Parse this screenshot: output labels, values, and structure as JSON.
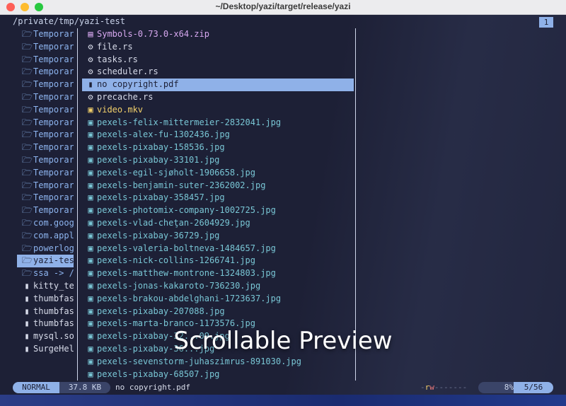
{
  "window": {
    "title": "~/Desktop/yazi/target/release/yazi"
  },
  "header": {
    "path": "/private/tmp/yazi-test",
    "tab": "1"
  },
  "parent": [
    {
      "icon": "folder-open-icon",
      "glyph": "🗁",
      "name": "Temporar",
      "kind": "dir"
    },
    {
      "icon": "folder-open-icon",
      "glyph": "🗁",
      "name": "Temporar",
      "kind": "dir"
    },
    {
      "icon": "folder-open-icon",
      "glyph": "🗁",
      "name": "Temporar",
      "kind": "dir"
    },
    {
      "icon": "folder-open-icon",
      "glyph": "🗁",
      "name": "Temporar",
      "kind": "dir"
    },
    {
      "icon": "folder-open-icon",
      "glyph": "🗁",
      "name": "Temporar",
      "kind": "dir"
    },
    {
      "icon": "folder-open-icon",
      "glyph": "🗁",
      "name": "Temporar",
      "kind": "dir"
    },
    {
      "icon": "folder-open-icon",
      "glyph": "🗁",
      "name": "Temporar",
      "kind": "dir"
    },
    {
      "icon": "folder-open-icon",
      "glyph": "🗁",
      "name": "Temporar",
      "kind": "dir"
    },
    {
      "icon": "folder-open-icon",
      "glyph": "🗁",
      "name": "Temporar",
      "kind": "dir"
    },
    {
      "icon": "folder-open-icon",
      "glyph": "🗁",
      "name": "Temporar",
      "kind": "dir"
    },
    {
      "icon": "folder-open-icon",
      "glyph": "🗁",
      "name": "Temporar",
      "kind": "dir"
    },
    {
      "icon": "folder-open-icon",
      "glyph": "🗁",
      "name": "Temporar",
      "kind": "dir"
    },
    {
      "icon": "folder-open-icon",
      "glyph": "🗁",
      "name": "Temporar",
      "kind": "dir"
    },
    {
      "icon": "folder-open-icon",
      "glyph": "🗁",
      "name": "Temporar",
      "kind": "dir"
    },
    {
      "icon": "folder-open-icon",
      "glyph": "🗁",
      "name": "Temporar",
      "kind": "dir"
    },
    {
      "icon": "folder-open-icon",
      "glyph": "🗁",
      "name": "com.goog",
      "kind": "dir"
    },
    {
      "icon": "folder-open-icon",
      "glyph": "🗁",
      "name": "com.appl",
      "kind": "dir"
    },
    {
      "icon": "folder-open-icon",
      "glyph": "🗁",
      "name": "powerlog",
      "kind": "dir"
    },
    {
      "icon": "folder-open-icon",
      "glyph": "🗁",
      "name": "yazi-tes",
      "kind": "dir",
      "selected": true
    },
    {
      "icon": "folder-open-icon",
      "glyph": "🗁",
      "name": "ssa -> /",
      "kind": "dir"
    },
    {
      "icon": "file-icon",
      "glyph": "▮",
      "name": "kitty_te",
      "kind": "file"
    },
    {
      "icon": "file-icon",
      "glyph": "▮",
      "name": "thumbfas",
      "kind": "file"
    },
    {
      "icon": "file-icon",
      "glyph": "▮",
      "name": "thumbfas",
      "kind": "file"
    },
    {
      "icon": "file-icon",
      "glyph": "▮",
      "name": "thumbfas",
      "kind": "file"
    },
    {
      "icon": "file-icon",
      "glyph": "▮",
      "name": "mysql.so",
      "kind": "file"
    },
    {
      "icon": "file-icon",
      "glyph": "▮",
      "name": "SurgeHel",
      "kind": "file"
    }
  ],
  "current": [
    {
      "icon": "archive-icon",
      "glyph": "▤",
      "name": "Symbols-0.73.0-x64.zip",
      "kind": "zip"
    },
    {
      "icon": "rust-file-icon",
      "glyph": "⚙",
      "name": "file.rs",
      "kind": "file"
    },
    {
      "icon": "rust-file-icon",
      "glyph": "⚙",
      "name": "tasks.rs",
      "kind": "file"
    },
    {
      "icon": "rust-file-icon",
      "glyph": "⚙",
      "name": "scheduler.rs",
      "kind": "file"
    },
    {
      "icon": "pdf-file-icon",
      "glyph": "▮",
      "name": "no copyright.pdf",
      "kind": "file",
      "selected": true
    },
    {
      "icon": "rust-file-icon",
      "glyph": "⚙",
      "name": "precache.rs",
      "kind": "file"
    },
    {
      "icon": "video-file-icon",
      "glyph": "▣",
      "name": "video.mkv",
      "kind": "mkv"
    },
    {
      "icon": "image-file-icon",
      "glyph": "▣",
      "name": "pexels-felix-mittermeier-2832041.jpg",
      "kind": "img"
    },
    {
      "icon": "image-file-icon",
      "glyph": "▣",
      "name": "pexels-alex-fu-1302436.jpg",
      "kind": "img"
    },
    {
      "icon": "image-file-icon",
      "glyph": "▣",
      "name": "pexels-pixabay-158536.jpg",
      "kind": "img"
    },
    {
      "icon": "image-file-icon",
      "glyph": "▣",
      "name": "pexels-pixabay-33101.jpg",
      "kind": "img"
    },
    {
      "icon": "image-file-icon",
      "glyph": "▣",
      "name": "pexels-egil-sjøholt-1906658.jpg",
      "kind": "img"
    },
    {
      "icon": "image-file-icon",
      "glyph": "▣",
      "name": "pexels-benjamin-suter-2362002.jpg",
      "kind": "img"
    },
    {
      "icon": "image-file-icon",
      "glyph": "▣",
      "name": "pexels-pixabay-358457.jpg",
      "kind": "img"
    },
    {
      "icon": "image-file-icon",
      "glyph": "▣",
      "name": "pexels-photomix-company-1002725.jpg",
      "kind": "img"
    },
    {
      "icon": "image-file-icon",
      "glyph": "▣",
      "name": "pexels-vlad-cheţan-2604929.jpg",
      "kind": "img"
    },
    {
      "icon": "image-file-icon",
      "glyph": "▣",
      "name": "pexels-pixabay-36729.jpg",
      "kind": "img"
    },
    {
      "icon": "image-file-icon",
      "glyph": "▣",
      "name": "pexels-valeria-boltneva-1484657.jpg",
      "kind": "img"
    },
    {
      "icon": "image-file-icon",
      "glyph": "▣",
      "name": "pexels-nick-collins-1266741.jpg",
      "kind": "img"
    },
    {
      "icon": "image-file-icon",
      "glyph": "▣",
      "name": "pexels-matthew-montrone-1324803.jpg",
      "kind": "img"
    },
    {
      "icon": "image-file-icon",
      "glyph": "▣",
      "name": "pexels-jonas-kakaroto-736230.jpg",
      "kind": "img"
    },
    {
      "icon": "image-file-icon",
      "glyph": "▣",
      "name": "pexels-brakou-abdelghani-1723637.jpg",
      "kind": "img"
    },
    {
      "icon": "image-file-icon",
      "glyph": "▣",
      "name": "pexels-pixabay-207088.jpg",
      "kind": "img"
    },
    {
      "icon": "image-file-icon",
      "glyph": "▣",
      "name": "pexels-marta-branco-1173576.jpg",
      "kind": "img"
    },
    {
      "icon": "image-file-icon",
      "glyph": "▣",
      "name": "pexels-pixabay-32...09.jpg",
      "kind": "img"
    },
    {
      "icon": "image-file-icon",
      "glyph": "▣",
      "name": "pexels-pixabay-36...jpg",
      "kind": "img"
    },
    {
      "icon": "image-file-icon",
      "glyph": "▣",
      "name": "pexels-sevenstorm-juhaszimrus-891030.jpg",
      "kind": "img"
    },
    {
      "icon": "image-file-icon",
      "glyph": "▣",
      "name": "pexels-pixabay-68507.jpg",
      "kind": "img"
    }
  ],
  "status": {
    "mode": "NORMAL",
    "size": "37.8 KB",
    "name": "no copyright.pdf",
    "perm_dash": "-",
    "perm_r": "r",
    "perm_w": "w",
    "perm_rest": "-------",
    "percent": "8%",
    "position": "5/56"
  },
  "overlay": {
    "caption": "Scrollable Preview"
  },
  "colors": {
    "accent": "#8fb1e8",
    "background": "#1d2036",
    "dir": "#8db4ef",
    "image": "#79c6d5",
    "zip": "#d7a8f0",
    "video": "#f2d06b"
  }
}
